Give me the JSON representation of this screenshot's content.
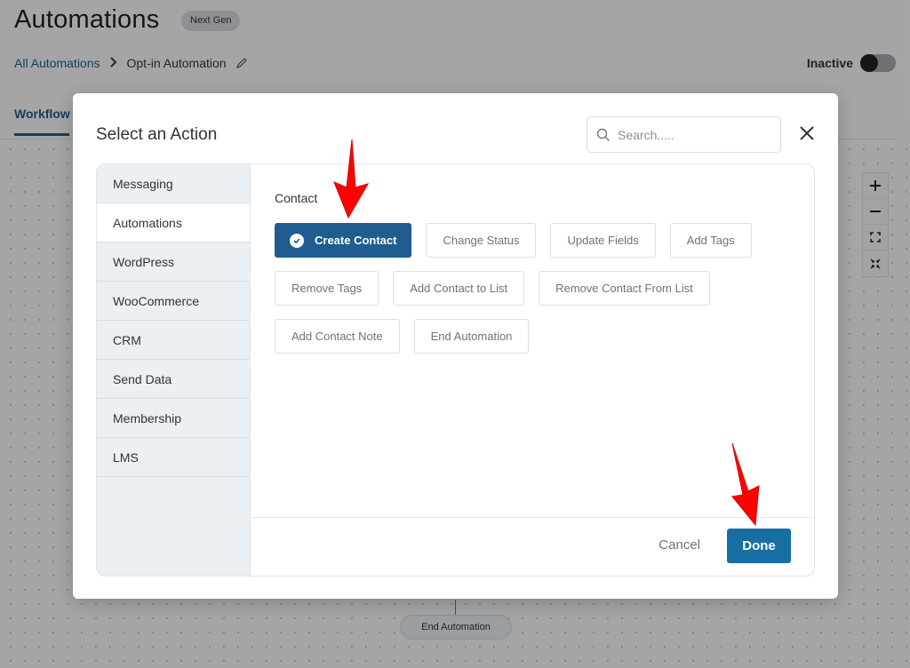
{
  "header": {
    "title": "Automations",
    "badge": "Next Gen",
    "breadcrumb": {
      "root": "All Automations",
      "current": "Opt-in Automation"
    },
    "status_label": "Inactive",
    "status_active": false
  },
  "tabs": [
    {
      "label": "Workflow",
      "active": true
    }
  ],
  "canvas": {
    "zoom_controls": [
      "zoom-in",
      "zoom-out",
      "fit-screen",
      "collapse"
    ],
    "end_node_label": "End Automation"
  },
  "modal": {
    "title": "Select an Action",
    "search_placeholder": "Search.....",
    "sidebar": [
      {
        "label": "Messaging",
        "active": false
      },
      {
        "label": "Automations",
        "active": true
      },
      {
        "label": "WordPress",
        "active": false
      },
      {
        "label": "WooCommerce",
        "active": false
      },
      {
        "label": "CRM",
        "active": false
      },
      {
        "label": "Send Data",
        "active": false
      },
      {
        "label": "Membership",
        "active": false
      },
      {
        "label": "LMS",
        "active": false
      }
    ],
    "section_label": "Contact",
    "actions": [
      {
        "label": "Create Contact",
        "selected": true
      },
      {
        "label": "Change Status",
        "selected": false
      },
      {
        "label": "Update Fields",
        "selected": false
      },
      {
        "label": "Add Tags",
        "selected": false
      },
      {
        "label": "Remove Tags",
        "selected": false
      },
      {
        "label": "Add Contact to List",
        "selected": false
      },
      {
        "label": "Remove Contact From List",
        "selected": false
      },
      {
        "label": "Add Contact Note",
        "selected": false
      },
      {
        "label": "End Automation",
        "selected": false
      }
    ],
    "cancel_label": "Cancel",
    "done_label": "Done"
  },
  "colors": {
    "primary": "#1f5c8f",
    "done_button": "#176ea3",
    "link": "#1e5f86",
    "annotation_arrow": "#ff0000"
  }
}
